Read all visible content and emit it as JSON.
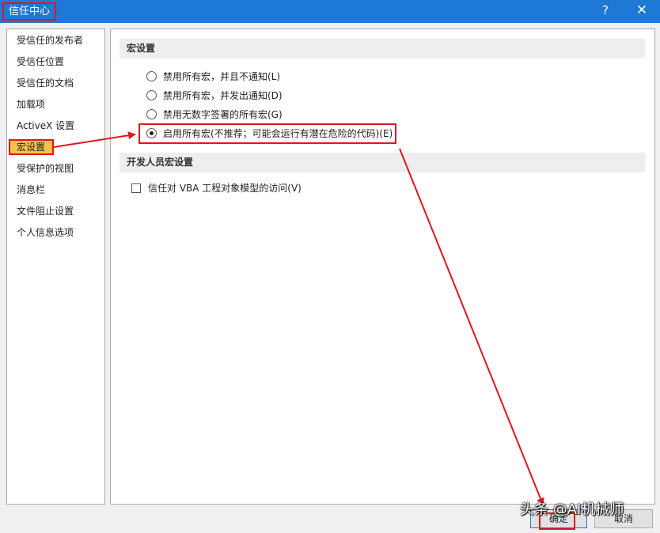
{
  "window": {
    "title": "信任中心",
    "help": "?",
    "close": "✕"
  },
  "sidebar": {
    "items": [
      {
        "label": "受信任的发布者"
      },
      {
        "label": "受信任位置"
      },
      {
        "label": "受信任的文档"
      },
      {
        "label": "加载项"
      },
      {
        "label": "ActiveX 设置"
      },
      {
        "label": "宏设置"
      },
      {
        "label": "受保护的视图"
      },
      {
        "label": "消息栏"
      },
      {
        "label": "文件阻止设置"
      },
      {
        "label": "个人信息选项"
      }
    ],
    "selected": "宏设置"
  },
  "macro_settings": {
    "heading": "宏设置",
    "options": [
      {
        "label": "禁用所有宏，并且不通知(L)",
        "selected": false
      },
      {
        "label": "禁用所有宏，并发出通知(D)",
        "selected": false
      },
      {
        "label": "禁用无数字签署的所有宏(G)",
        "selected": false
      },
      {
        "label": "启用所有宏(不推荐；可能会运行有潜在危险的代码)(E)",
        "selected": true
      }
    ]
  },
  "developer_settings": {
    "heading": "开发人员宏设置",
    "vba_label": "信任对 VBA 工程对象模型的访问(V)",
    "vba_checked": false
  },
  "buttons": {
    "ok": "确定",
    "cancel": "取消"
  },
  "watermark": "头条 @AI机械师",
  "annotation_color": "#e0161d",
  "accent_color": "#1e78d6"
}
